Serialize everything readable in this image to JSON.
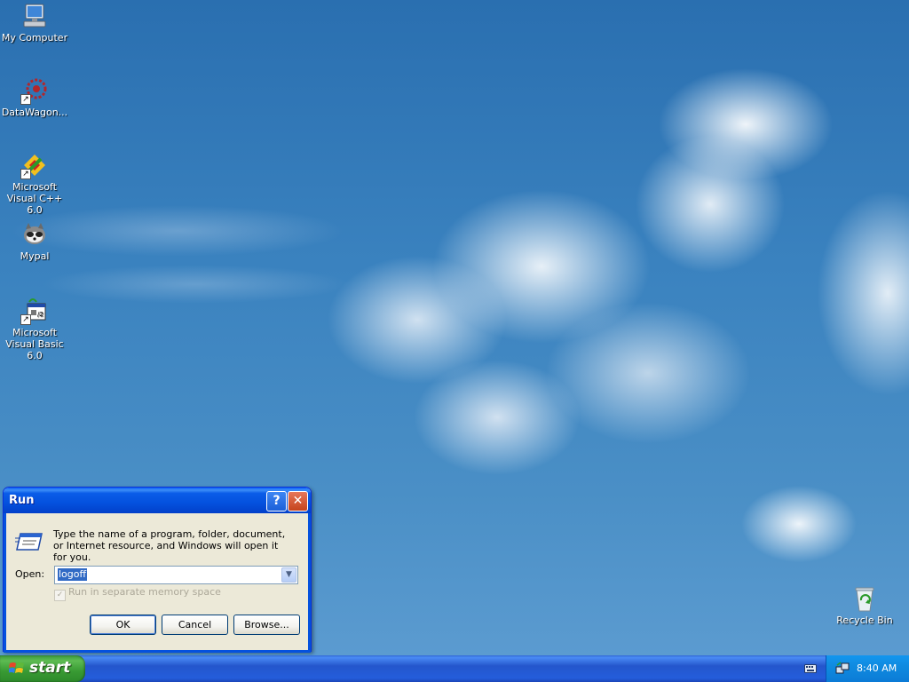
{
  "desktop": {
    "icons": [
      {
        "label": "My Computer",
        "icon": "my-computer-icon"
      },
      {
        "label": "DataWagon...",
        "icon": "datawagon-icon"
      },
      {
        "label": "Microsoft Visual C++ 6.0",
        "icon": "visual-cpp-icon"
      },
      {
        "label": "Mypal",
        "icon": "mypal-icon"
      },
      {
        "label": "Microsoft Visual Basic 6.0",
        "icon": "visual-basic-icon"
      },
      {
        "label": "Recycle Bin",
        "icon": "recycle-bin-icon"
      }
    ]
  },
  "run_dialog": {
    "title": "Run",
    "help_glyph": "?",
    "close_glyph": "✕",
    "description": "Type the name of a program, folder, document, or Internet resource, and Windows will open it for you.",
    "open_label": "Open:",
    "open_value": "logoff",
    "separate_memory_label": "Run in separate memory space",
    "separate_memory_checked": true,
    "buttons": {
      "ok": "OK",
      "cancel": "Cancel",
      "browse": "Browse..."
    }
  },
  "taskbar": {
    "start_label": "start",
    "clock": "8:40 AM"
  },
  "colors": {
    "titlebar": "#0451de",
    "taskbar": "#245ddb",
    "start_green": "#3c9a3c",
    "selection": "#316ac5"
  }
}
